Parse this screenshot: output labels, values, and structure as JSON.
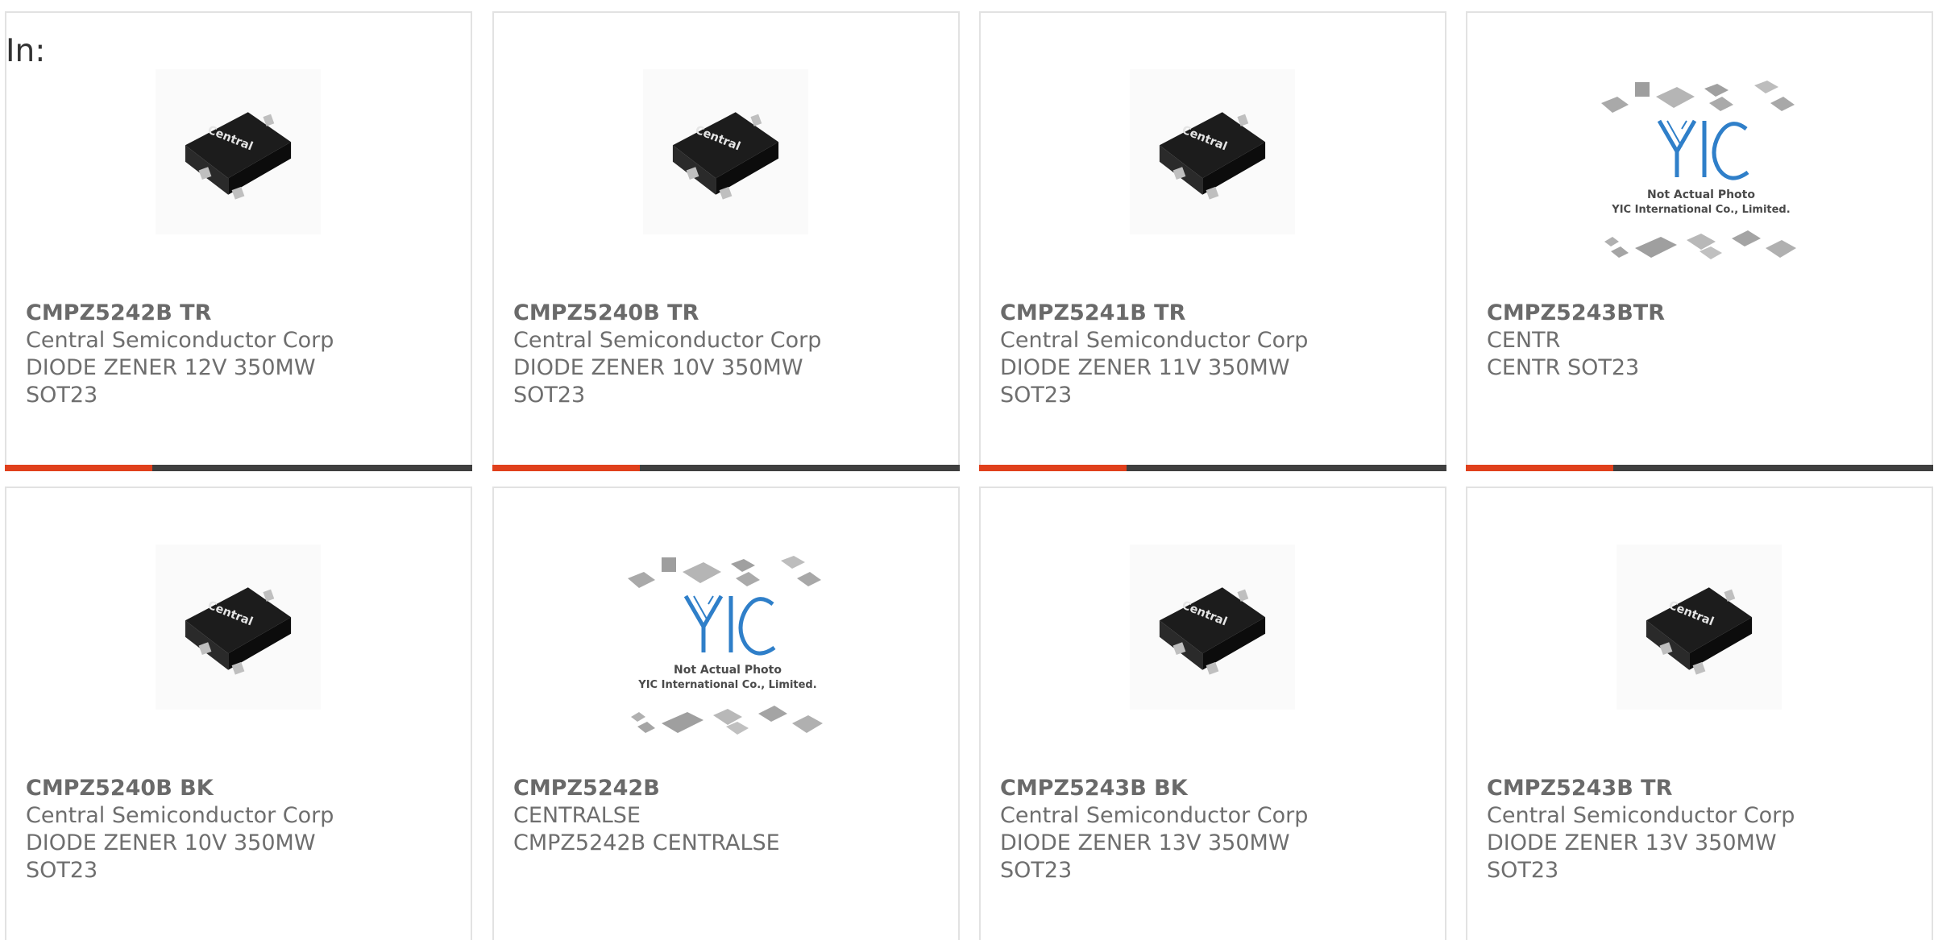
{
  "header": {
    "in_label": "In:"
  },
  "image_captions": {
    "not_actual_photo": "Not Actual Photo",
    "company": "YIC International Co., Limited."
  },
  "colors": {
    "accent_bar": "#e0401c",
    "dark_bar": "#3f3f3f",
    "card_border": "#e2e2e2",
    "text": "#6e6e6e"
  },
  "products": [
    {
      "part_number": "CMPZ5242B TR",
      "manufacturer": "Central Semiconductor Corp",
      "description_line1": "DIODE ZENER 12V 350MW",
      "description_line2": "SOT23",
      "image": "central-sot23-photo"
    },
    {
      "part_number": "CMPZ5240B TR",
      "manufacturer": "Central Semiconductor Corp",
      "description_line1": "DIODE ZENER 10V 350MW",
      "description_line2": "SOT23",
      "image": "central-sot23-photo"
    },
    {
      "part_number": "CMPZ5241B TR",
      "manufacturer": "Central Semiconductor Corp",
      "description_line1": "DIODE ZENER 11V 350MW",
      "description_line2": "SOT23",
      "image": "central-sot23-photo"
    },
    {
      "part_number": "CMPZ5243BTR",
      "manufacturer": "CENTR",
      "description_line1": "CENTR SOT23",
      "description_line2": "",
      "image": "yic-not-actual-photo"
    },
    {
      "part_number": "CMPZ5240B BK",
      "manufacturer": "Central Semiconductor Corp",
      "description_line1": "DIODE ZENER 10V 350MW",
      "description_line2": "SOT23",
      "image": "central-sot23-photo"
    },
    {
      "part_number": "CMPZ5242B",
      "manufacturer": "CENTRALSE",
      "description_line1": "CMPZ5242B CENTRALSE",
      "description_line2": "",
      "image": "yic-not-actual-photo"
    },
    {
      "part_number": "CMPZ5243B BK",
      "manufacturer": "Central Semiconductor Corp",
      "description_line1": "DIODE ZENER 13V 350MW",
      "description_line2": "SOT23",
      "image": "central-sot23-photo"
    },
    {
      "part_number": "CMPZ5243B TR",
      "manufacturer": "Central Semiconductor Corp",
      "description_line1": "DIODE ZENER 13V 350MW",
      "description_line2": "SOT23",
      "image": "central-sot23-photo"
    }
  ]
}
